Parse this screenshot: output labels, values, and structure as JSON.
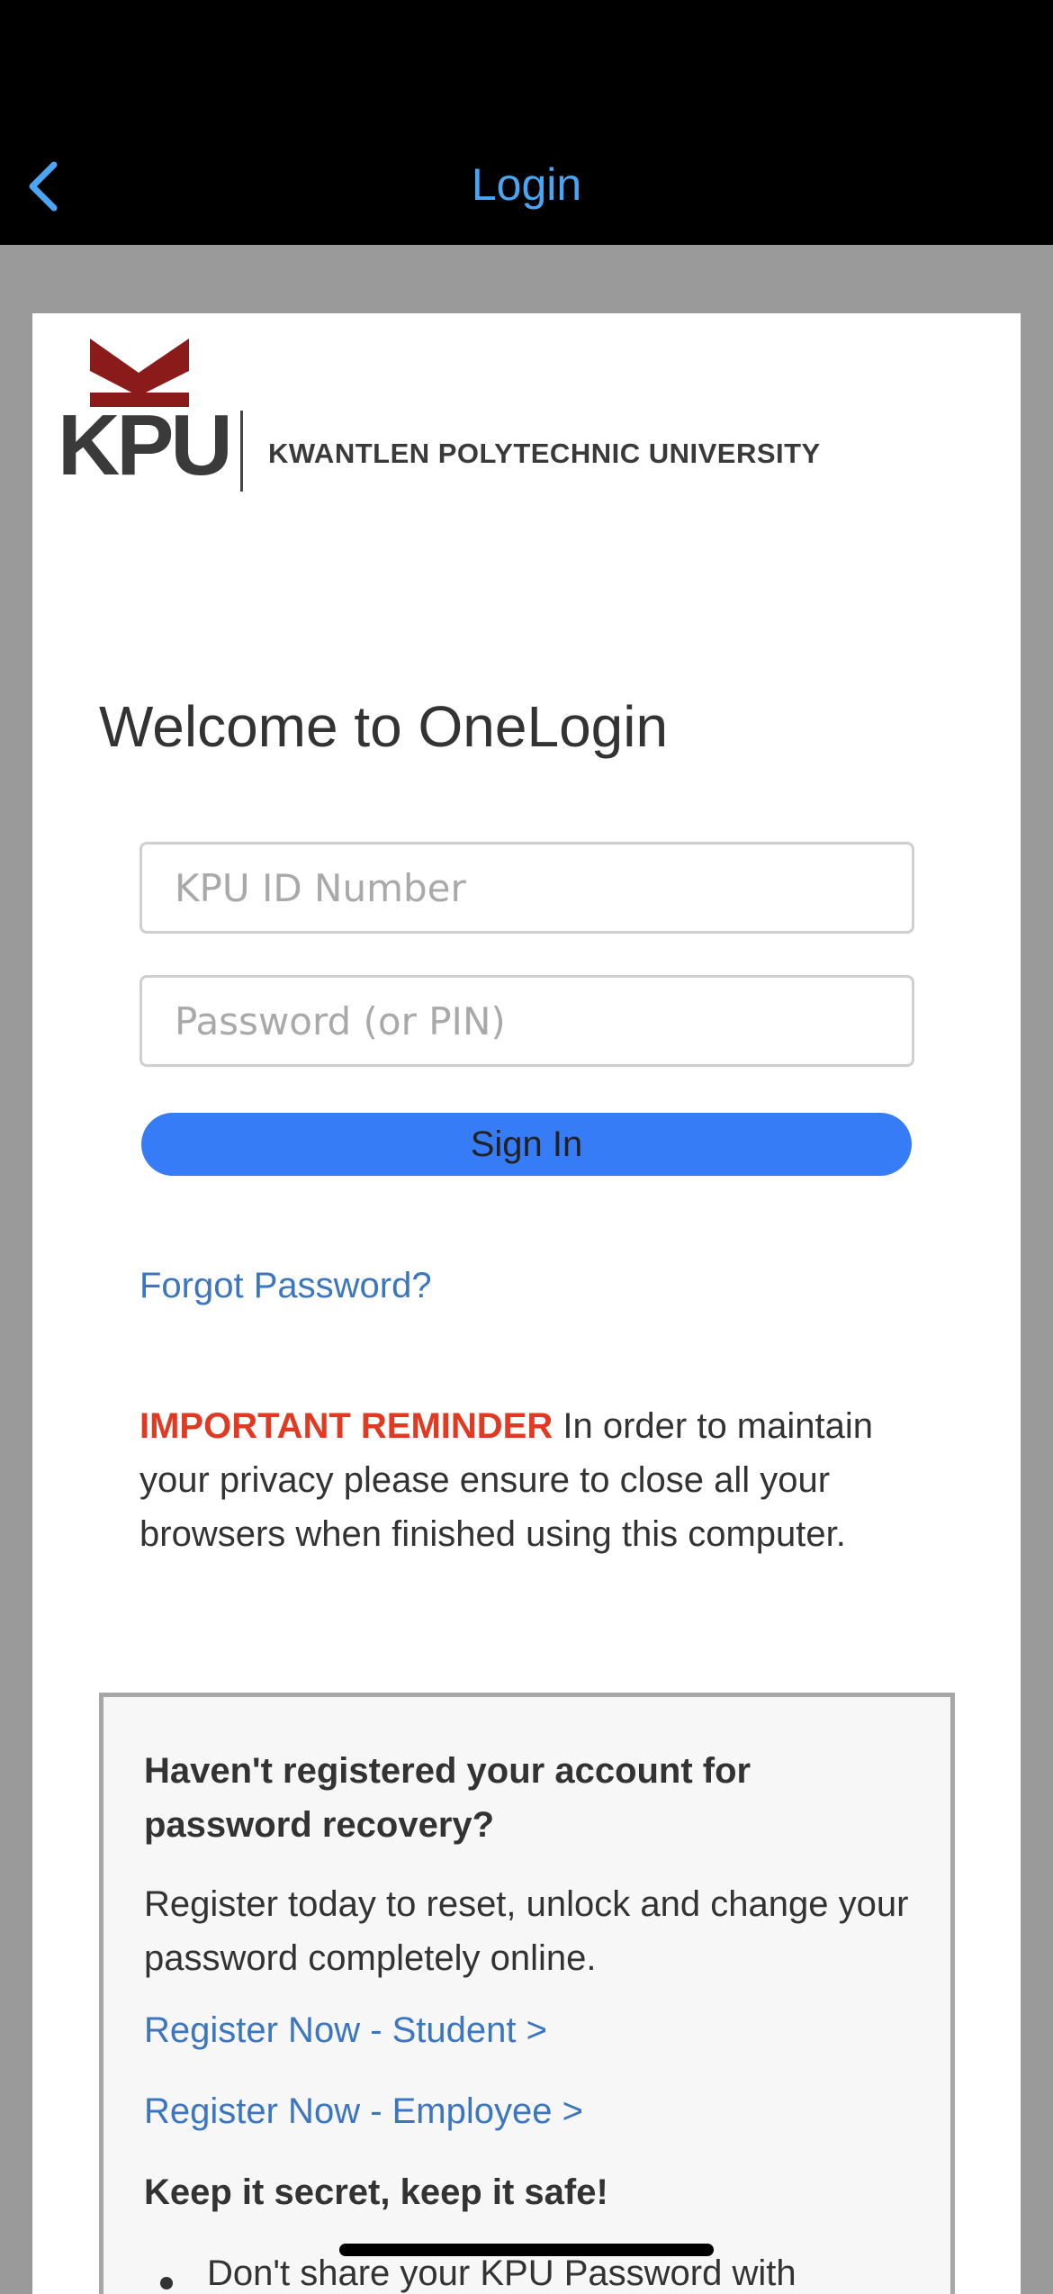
{
  "nav": {
    "title": "Login",
    "back_icon": "chevron-left-icon",
    "accent_color": "#4aa6f2"
  },
  "logo": {
    "abbreviation": "KPU",
    "name": "KWANTLEN POLYTECHNIC UNIVERSITY",
    "mark_color": "#8b1a1a"
  },
  "welcome": "Welcome to OneLogin",
  "form": {
    "id_placeholder": "KPU ID Number",
    "id_value": "",
    "password_placeholder": "Password (or PIN)",
    "password_value": "",
    "signin_label": "Sign In",
    "signin_color": "#377cf7"
  },
  "forgot_password": "Forgot Password?",
  "reminder": {
    "important": "IMPORTANT REMINDER",
    "text": " In order to maintain your privacy please ensure to close all your browsers when finished using this computer.",
    "important_color": "#e03a22"
  },
  "registration": {
    "heading": "Haven't registered your account for password recovery?",
    "body": "Register today to reset, unlock and change your password completely online.",
    "student_link": "Register Now - Student >",
    "employee_link": "Register Now - Employee >",
    "secret_heading": "Keep it secret, keep it safe!",
    "bullet_1": "Don't share your KPU Password with"
  },
  "link_color": "#3c76c1"
}
